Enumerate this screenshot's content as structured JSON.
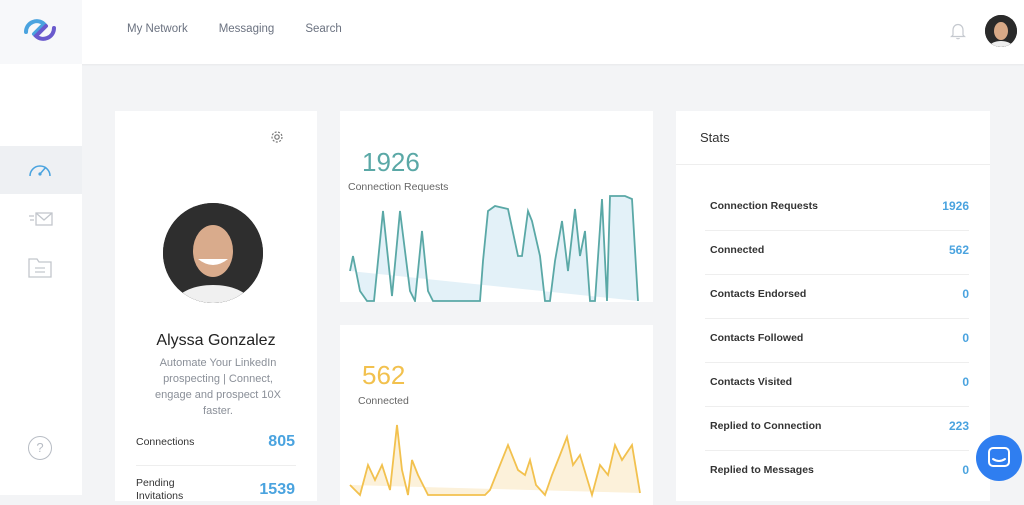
{
  "nav": {
    "items": [
      "My Network",
      "Messaging",
      "Search"
    ]
  },
  "profile": {
    "name": "Alyssa Gonzalez",
    "description": "Automate Your LinkedIn prospecting | Connect, engage and prospect 10X faster.",
    "connections_label": "Connections",
    "connections_value": "805",
    "pending_label": "Pending Invitations",
    "pending_value": "1539"
  },
  "chart1": {
    "value": "1926",
    "label": "Connection Requests",
    "color": "#5aa8a6"
  },
  "chart2": {
    "value": "562",
    "label": "Connected",
    "color": "#f2c14e"
  },
  "stats": {
    "title": "Stats",
    "rows": [
      {
        "label": "Connection Requests",
        "value": "1926"
      },
      {
        "label": "Connected",
        "value": "562"
      },
      {
        "label": "Contacts Endorsed",
        "value": "0"
      },
      {
        "label": "Contacts Followed",
        "value": "0"
      },
      {
        "label": "Contacts Visited",
        "value": "0"
      },
      {
        "label": "Replied to Connection",
        "value": "223"
      },
      {
        "label": "Replied to Messages",
        "value": "0"
      }
    ]
  },
  "icons": {
    "logo": "logo-icon",
    "bell": "bell-icon",
    "dashboard": "speedometer-icon",
    "messages": "mail-icon",
    "files": "folder-icon",
    "help": "help-icon",
    "settings": "gear-icon",
    "chat": "chat-icon"
  },
  "colors": {
    "accent": "#4aa3df",
    "teal": "#5aa8a6",
    "yellow": "#f2c14e",
    "chat_button": "#2f7ef0"
  }
}
